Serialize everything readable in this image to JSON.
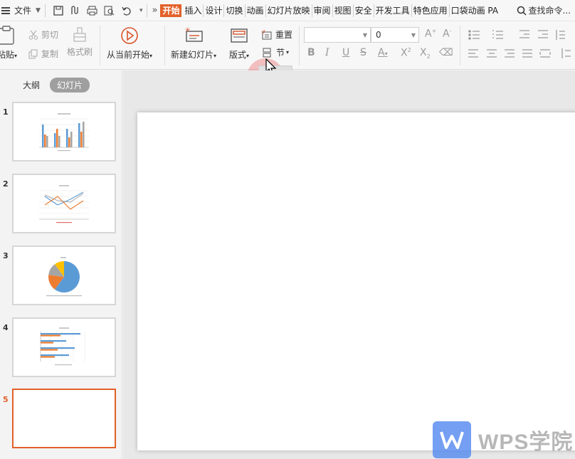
{
  "menu": {
    "file_label": "文件",
    "tabs": [
      "开始",
      "插入",
      "设计",
      "切换",
      "动画",
      "幻灯片放映",
      "审阅",
      "视图",
      "安全",
      "开发工具",
      "特色应用",
      "口袋动画 PA"
    ],
    "active_tab": "开始",
    "search_label": "查找命令..."
  },
  "ribbon": {
    "paste_label": "粘贴",
    "cut_label": "剪切",
    "copy_label": "复制",
    "format_painter_label": "格式刷",
    "play_from_current_label": "从当前开始",
    "new_slide_label": "新建幻灯片",
    "layout_label": "版式",
    "reset_label": "重置",
    "section_label": "节",
    "font_size_value": "0"
  },
  "panel": {
    "outline_tab": "大纲",
    "slides_tab": "幻灯片"
  },
  "slides": [
    {
      "number": "1",
      "chart": "bar"
    },
    {
      "number": "2",
      "chart": "line"
    },
    {
      "number": "3",
      "chart": "pie"
    },
    {
      "number": "4",
      "chart": "hbar"
    },
    {
      "number": "5",
      "chart": "blank"
    }
  ],
  "active_slide": "5",
  "watermark": {
    "text": "WPS学院"
  },
  "colors": {
    "accent": "#e2612a",
    "blue": "#5b9bd5",
    "orange": "#ed7d31",
    "gray": "#a5a5a5",
    "yellow": "#ffc000"
  }
}
